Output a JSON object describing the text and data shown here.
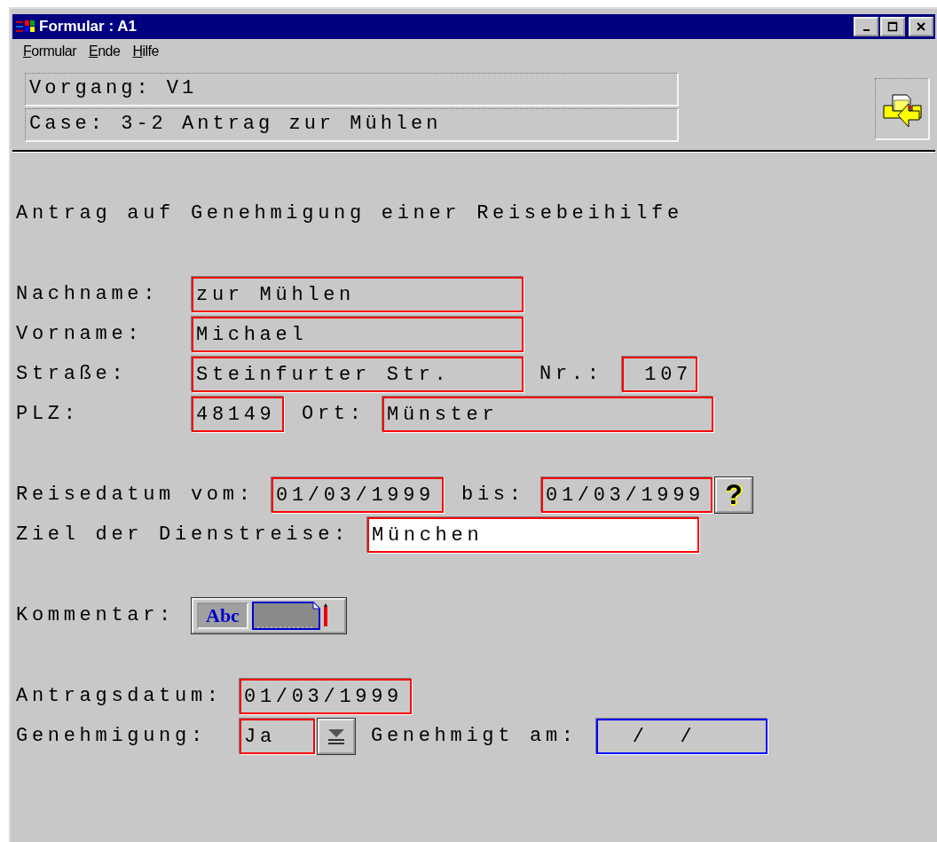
{
  "window": {
    "title": "Formular : A1"
  },
  "menu": [
    "Formular",
    "Ende",
    "Hilfe"
  ],
  "header": {
    "fields": [
      "Vorgang: V1",
      "Case: 3-2 Antrag zur Mühlen"
    ]
  },
  "form": {
    "title": "Antrag auf Genehmigung einer Reisebeihilfe",
    "groups": [
      [
        [
          {
            "kind": "label",
            "text": "Nachname:"
          },
          {
            "kind": "field",
            "value": "zur Mühlen",
            "color": "#ff0000",
            "editable": false
          }
        ],
        [
          {
            "kind": "label",
            "text": "Vorname:"
          },
          {
            "kind": "field",
            "value": "Michael",
            "color": "#ff0000",
            "editable": false
          }
        ],
        [
          {
            "kind": "label",
            "text": "Straße:"
          },
          {
            "kind": "field",
            "value": "Steinfurter Str.",
            "color": "#ff0000",
            "editable": false
          },
          {
            "kind": "label",
            "text": "Nr.:"
          },
          {
            "kind": "field",
            "value": "107",
            "color": "#ff0000",
            "editable": false
          }
        ],
        [
          {
            "kind": "label",
            "text": "PLZ:"
          },
          {
            "kind": "field",
            "value": "48149",
            "color": "#ff0000",
            "editable": false
          },
          {
            "kind": "label",
            "text": "Ort:"
          },
          {
            "kind": "field",
            "value": "Münster",
            "color": "#ff0000",
            "editable": false
          }
        ]
      ],
      [
        [
          {
            "kind": "label",
            "text": "Reisedatum vom:"
          },
          {
            "kind": "field",
            "value": "01/03/1999",
            "color": "#ff0000",
            "editable": false
          },
          {
            "kind": "label",
            "text": "bis:"
          },
          {
            "kind": "field",
            "value": "01/03/1999",
            "color": "#ff0000",
            "editable": false
          },
          {
            "kind": "help-button",
            "label": "?"
          }
        ],
        [
          {
            "kind": "label",
            "text": "Ziel der Dienstreise:"
          },
          {
            "kind": "field",
            "value": "München",
            "color": "#ff0000",
            "editable": true
          }
        ]
      ],
      [
        [
          {
            "kind": "label",
            "text": "Kommentar:"
          },
          {
            "kind": "comment-button",
            "label": "Abc"
          }
        ]
      ],
      [
        [
          {
            "kind": "label",
            "text": "Antragsdatum:"
          },
          {
            "kind": "field",
            "value": "01/03/1999",
            "color": "#ff0000",
            "editable": false
          }
        ],
        [
          {
            "kind": "label",
            "text": "Genehmigung:"
          },
          {
            "kind": "field",
            "value": "Ja",
            "color": "#ff0000",
            "editable": false
          },
          {
            "kind": "dropdown-button"
          },
          {
            "kind": "label",
            "text": "Genehmigt am:"
          },
          {
            "kind": "field",
            "value": "  /  /",
            "color": "#0000ff",
            "editable": false
          }
        ]
      ]
    ]
  }
}
